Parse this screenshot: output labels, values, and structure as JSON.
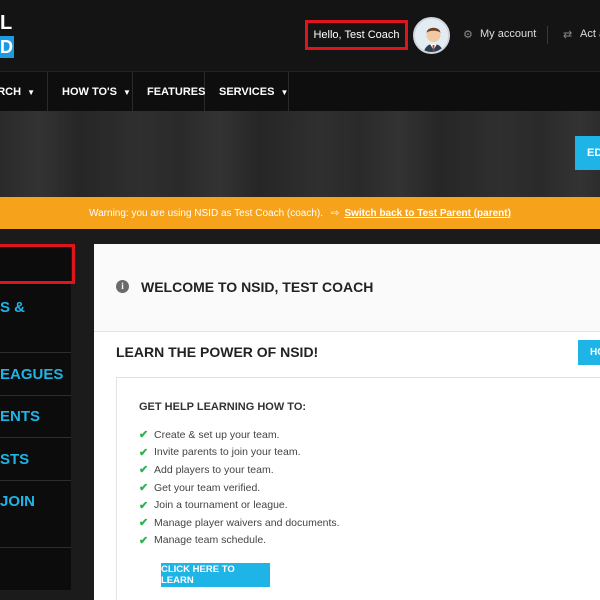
{
  "header": {
    "logo_line1": "L",
    "logo_line2": "D",
    "greeting": "Hello, Test Coach",
    "my_account": "My account",
    "act_as": "Act a"
  },
  "nav": {
    "items": [
      {
        "label": "ARCH"
      },
      {
        "label": "HOW TO'S"
      },
      {
        "label": "FEATURES"
      },
      {
        "label": "SERVICES"
      }
    ]
  },
  "hero": {
    "button_label": "ED"
  },
  "warning": {
    "message": "Warning: you are using NSID as Test Coach (coach).",
    "switch_link": "Switch back to Test Parent (parent)"
  },
  "sidebar": {
    "items": [
      {
        "label": "S &"
      },
      {
        "label": "EAGUES"
      },
      {
        "label": "ENTS"
      },
      {
        "label": "STS"
      },
      {
        "label": "JOIN"
      }
    ]
  },
  "main": {
    "welcome_title": "WELCOME TO NSID, TEST COACH",
    "learn_title": "LEARN THE POWER OF NSID!",
    "learn_button": "HO",
    "help_title": "GET HELP LEARNING HOW TO:",
    "help_items": [
      "Create & set up your team.",
      "Invite parents to join your team.",
      "Add players to your team.",
      "Get your team verified.",
      "Join a tournament or league.",
      "Manage player waivers and documents.",
      "Manage team schedule."
    ],
    "click_button": "CLICK HERE TO LEARN"
  },
  "colors": {
    "accent": "#1fb4e6",
    "warning": "#f7a21b",
    "highlight": "#e0141c",
    "check": "#2bb34a"
  },
  "icons": [
    "gear-icon",
    "swap-icon",
    "chevron-down-icon",
    "info-icon",
    "check-icon"
  ]
}
